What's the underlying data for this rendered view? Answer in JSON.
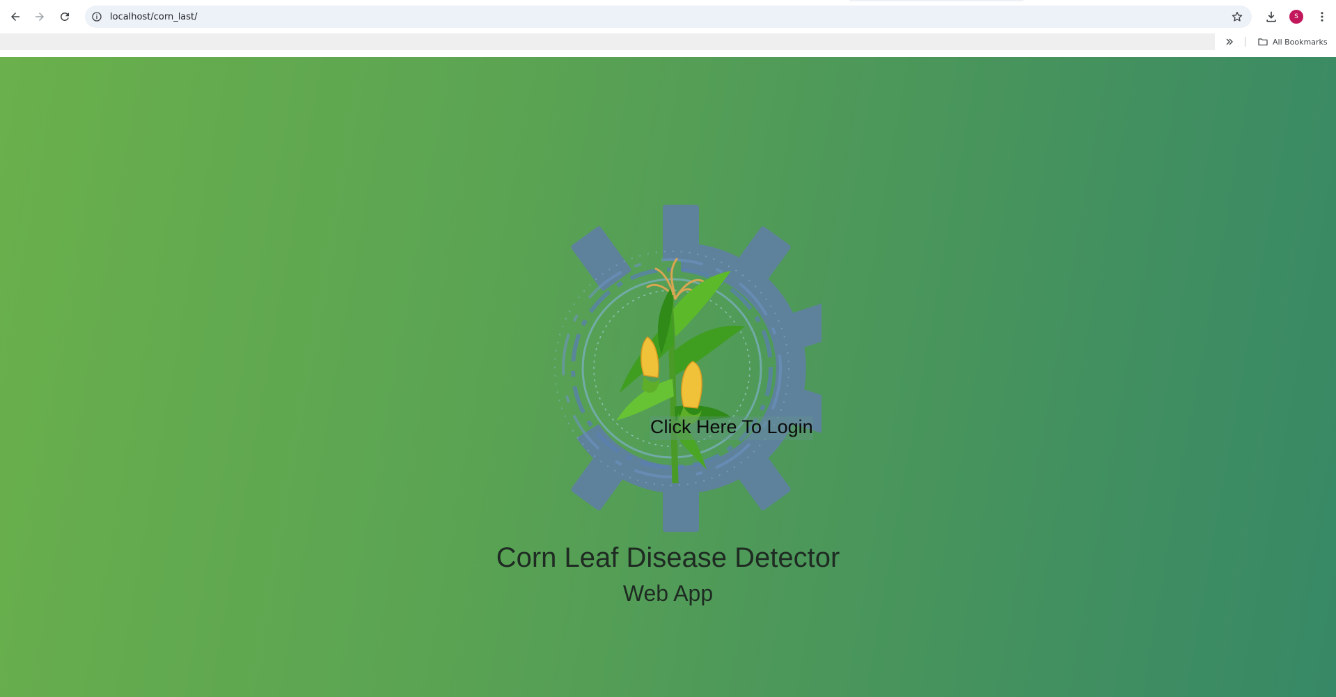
{
  "browser": {
    "url": "localhost/corn_last/",
    "bookmarks_label": "All Bookmarks",
    "profile_initial": "S",
    "profile_color": "#c2185b",
    "icons": {
      "back": "arrow-left-icon",
      "forward": "arrow-right-icon",
      "reload": "reload-icon",
      "site_info": "info-icon",
      "bookmark_star": "star-icon",
      "downloads": "download-icon",
      "menu": "kebab-menu-icon",
      "bookmarks_overflow": "double-chevron-icon",
      "bookmarks_folder": "folder-icon"
    }
  },
  "page": {
    "login_link": "Click Here To Login",
    "title": "Corn Leaf Disease Detector",
    "subtitle": "Web App",
    "colors": {
      "gradient_start": "#6ab04c",
      "gradient_end": "#378866",
      "gear": "#5f81a1",
      "leaf": "#3f9d1f",
      "corn_kernel": "#f0c23a",
      "tassel": "#d9a653"
    }
  }
}
